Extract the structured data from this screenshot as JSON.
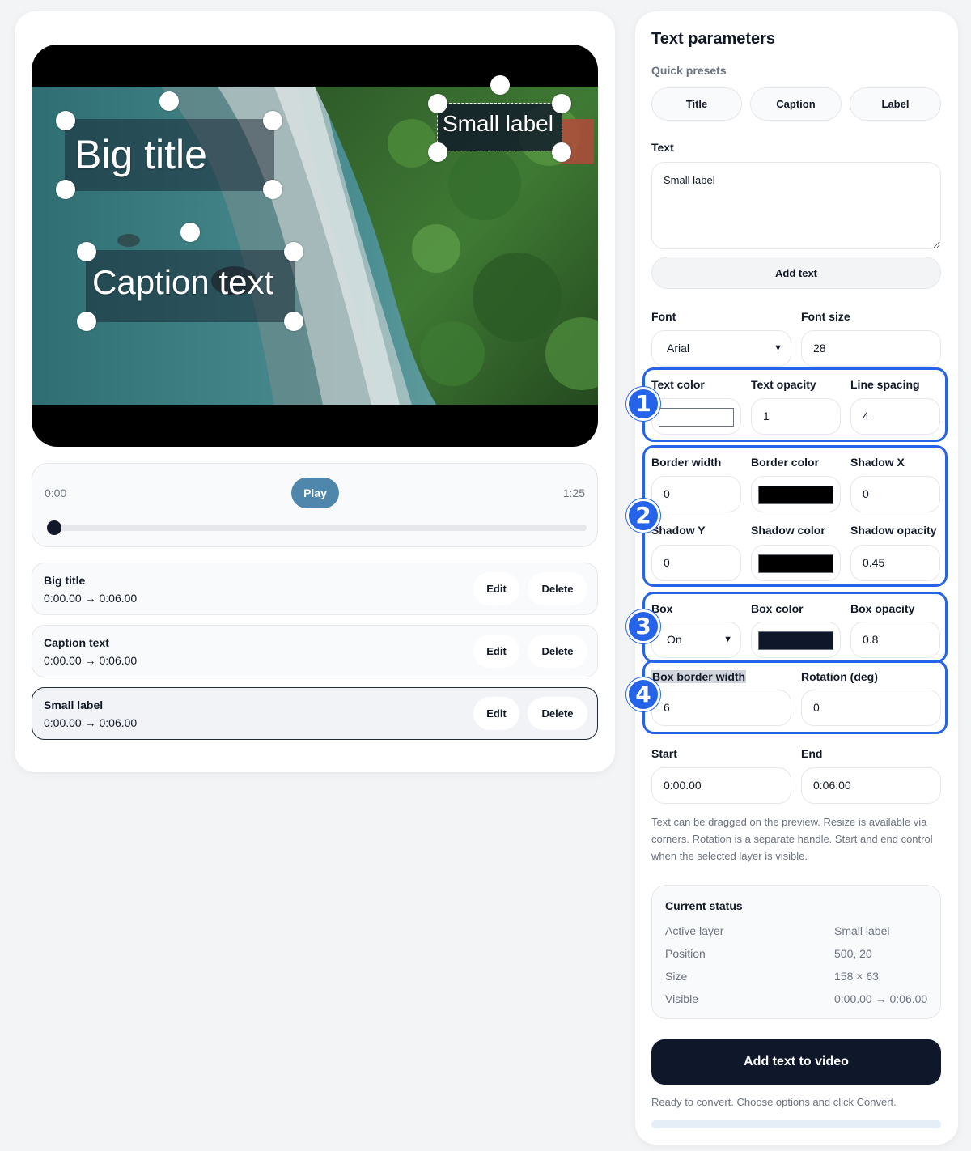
{
  "player": {
    "time_start": "0:00",
    "time_end": "1:25",
    "play_label": "Play",
    "progress_fraction": 0.0
  },
  "overlays": [
    {
      "text": "Big title",
      "font_size": 50,
      "box_opacity": 0.45
    },
    {
      "text": "Caption text",
      "font_size": 42,
      "box_opacity": 0.45
    },
    {
      "text": "Small label",
      "font_size": 28,
      "box_opacity": 0.8
    }
  ],
  "layers": [
    {
      "name": "Big title",
      "time": "0:00.00 → 0:06.00"
    },
    {
      "name": "Caption text",
      "time": "0:00.00 → 0:06.00"
    },
    {
      "name": "Small label",
      "time": "0:00.00 → 0:06.00"
    }
  ],
  "row_buttons": {
    "edit": "Edit",
    "delete": "Delete"
  },
  "panel": {
    "title": "Text parameters",
    "presets_label": "Quick presets",
    "presets": [
      "Title",
      "Caption",
      "Label"
    ],
    "text_label": "Text",
    "text_value": "Small label",
    "add_text_label": "Add text",
    "font_label": "Font",
    "font_value": "Arial",
    "font_size_label": "Font size",
    "font_size_value": "28",
    "text_color_label": "Text color",
    "text_color": "#ffffff",
    "text_opacity_label": "Text opacity",
    "text_opacity_value": "1",
    "line_spacing_label": "Line spacing",
    "line_spacing_value": "4",
    "border_width_label": "Border width",
    "border_width_value": "0",
    "border_color_label": "Border color",
    "border_color": "#000000",
    "shadow_x_label": "Shadow X",
    "shadow_x_value": "0",
    "shadow_y_label": "Shadow Y",
    "shadow_y_value": "0",
    "shadow_color_label": "Shadow color",
    "shadow_color": "#000000",
    "shadow_opacity_label": "Shadow opacity",
    "shadow_opacity_value": "0.45",
    "box_label": "Box",
    "box_value": "On",
    "box_color_label": "Box color",
    "box_color": "#0f172a",
    "box_opacity_label": "Box opacity",
    "box_opacity_value": "0.8",
    "box_border_width_label": "Box border width",
    "box_border_width_value": "6",
    "rotation_label": "Rotation (deg)",
    "rotation_value": "0",
    "start_label": "Start",
    "start_value": "0:00.00",
    "end_label": "End",
    "end_value": "0:06.00",
    "hint": "Text can be dragged on the preview. Resize is available via corners. Rotation is a separate handle. Start and end control when the selected layer is visible."
  },
  "status": {
    "title": "Current status",
    "rows": [
      {
        "key": "Active layer",
        "value": "Small label"
      },
      {
        "key": "Position",
        "value": "500, 20"
      },
      {
        "key": "Size",
        "value": "158 × 63"
      },
      {
        "key": "Visible",
        "value": "0:00.00 → 0:06.00"
      }
    ]
  },
  "annotations": [
    "1",
    "2",
    "3",
    "4"
  ],
  "convert_label": "Add text to video",
  "ready_text": "Ready to convert. Choose options and click Convert.",
  "convert_progress_fraction": 0.0,
  "colors": {
    "accent": "#4f86ab",
    "annotation": "#2563eb",
    "dark": "#0f172a"
  }
}
